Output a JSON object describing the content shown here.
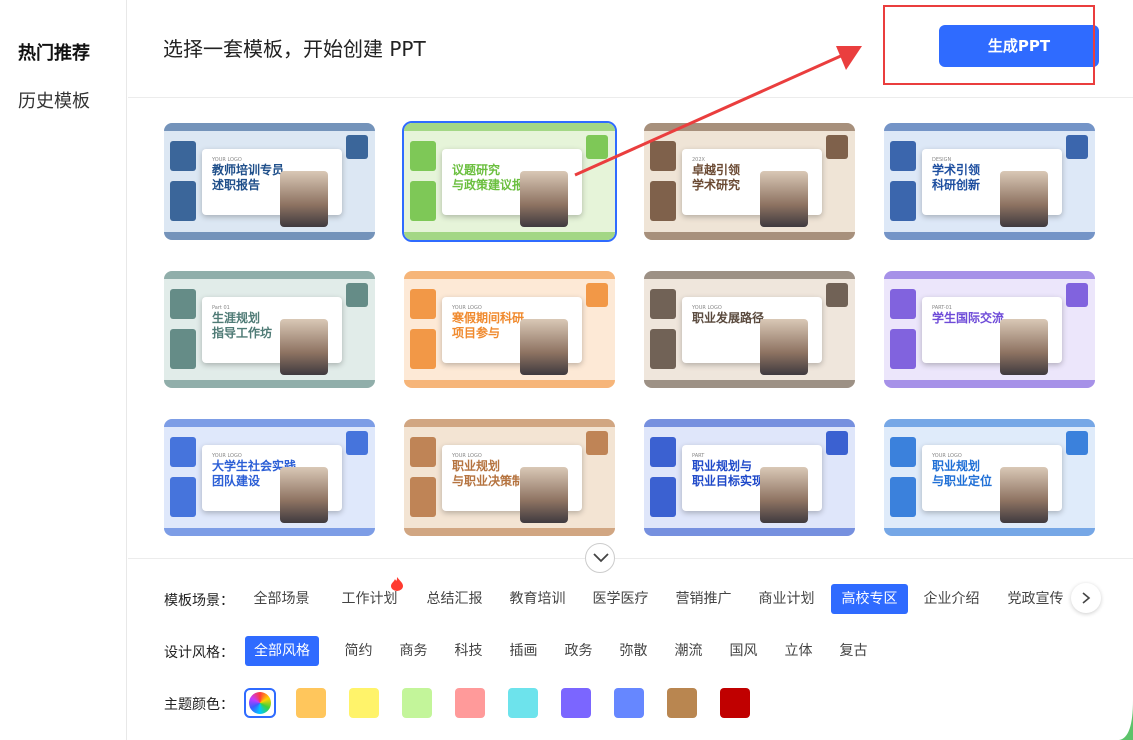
{
  "sidebar": {
    "items": [
      {
        "label": "热门推荐",
        "active": true
      },
      {
        "label": "历史模板",
        "active": false
      }
    ]
  },
  "header": {
    "title": "选择一套模板，开始创建 PPT",
    "generate_label": "生成PPT"
  },
  "templates": [
    {
      "title": "教师培训专员\n述职报告",
      "subtitle": "YOUR LOGO",
      "color": "#1f4f8a",
      "accent": "#dce7f3",
      "selected": false
    },
    {
      "title": "议题研究\n与政策建议报告",
      "subtitle": "",
      "color": "#6bbf3f",
      "accent": "#e6f4d9",
      "selected": true
    },
    {
      "title": "卓越引领\n学术研究",
      "subtitle": "202X",
      "color": "#6b4a33",
      "accent": "#efe4d6",
      "selected": false
    },
    {
      "title": "学术引领\n科研创新",
      "subtitle": "DESIGN",
      "color": "#1e4fa0",
      "accent": "#dde8f7",
      "selected": false
    },
    {
      "title": "生涯规划\n指导工作坊",
      "subtitle": "Part 01",
      "color": "#4f7b76",
      "accent": "#e1ece9",
      "selected": false
    },
    {
      "title": "寒假期间科研\n项目参与",
      "subtitle": "YOUR LOGO",
      "color": "#f08a2e",
      "accent": "#fde9d6",
      "selected": false
    },
    {
      "title": "职业发展路径",
      "subtitle": "YOUR LOGO",
      "color": "#5a4a3e",
      "accent": "#efe6dc",
      "selected": false
    },
    {
      "title": "学生国际交流",
      "subtitle": "PART-01",
      "color": "#6e4bd8",
      "accent": "#ece6fb",
      "selected": false
    },
    {
      "title": "大学生社会实践\n团队建设",
      "subtitle": "YOUR LOGO",
      "color": "#2c5fd6",
      "accent": "#dfe8fb",
      "selected": false
    },
    {
      "title": "职业规划\n与职业决策制定",
      "subtitle": "YOUR LOGO",
      "color": "#b5733f",
      "accent": "#f3e4d3",
      "selected": false
    },
    {
      "title": "职业规划与\n职业目标实现",
      "subtitle": "PART",
      "color": "#1f49c9",
      "accent": "#dfe6fa",
      "selected": false
    },
    {
      "title": "职业规划\n与职业定位",
      "subtitle": "YOUR LOGO",
      "color": "#1f6fd6",
      "accent": "#dfebfa",
      "selected": false
    }
  ],
  "filters": {
    "scene": {
      "label": "模板场景：",
      "options": [
        "全部场景",
        "工作计划",
        "总结汇报",
        "教育培训",
        "医学医疗",
        "营销推广",
        "商业计划",
        "高校专区",
        "企业介绍",
        "党政宣传"
      ],
      "active": "高校专区",
      "hot": "工作计划"
    },
    "style": {
      "label": "设计风格：",
      "options": [
        "全部风格",
        "简约",
        "商务",
        "科技",
        "插画",
        "政务",
        "弥散",
        "潮流",
        "国风",
        "立体",
        "复古"
      ],
      "active": "全部风格"
    },
    "color": {
      "label": "主题颜色：",
      "swatches": [
        "#ffc65c",
        "#fff36a",
        "#c3f59a",
        "#ff9a9a",
        "#6de3ec",
        "#7b66ff",
        "#6687ff",
        "#b98650",
        "#c00000"
      ]
    }
  },
  "icons": {
    "collapse": "chevron-down-icon",
    "next": "chevron-right-icon",
    "hot": "flame-icon",
    "all_colors": "color-wheel-icon"
  }
}
